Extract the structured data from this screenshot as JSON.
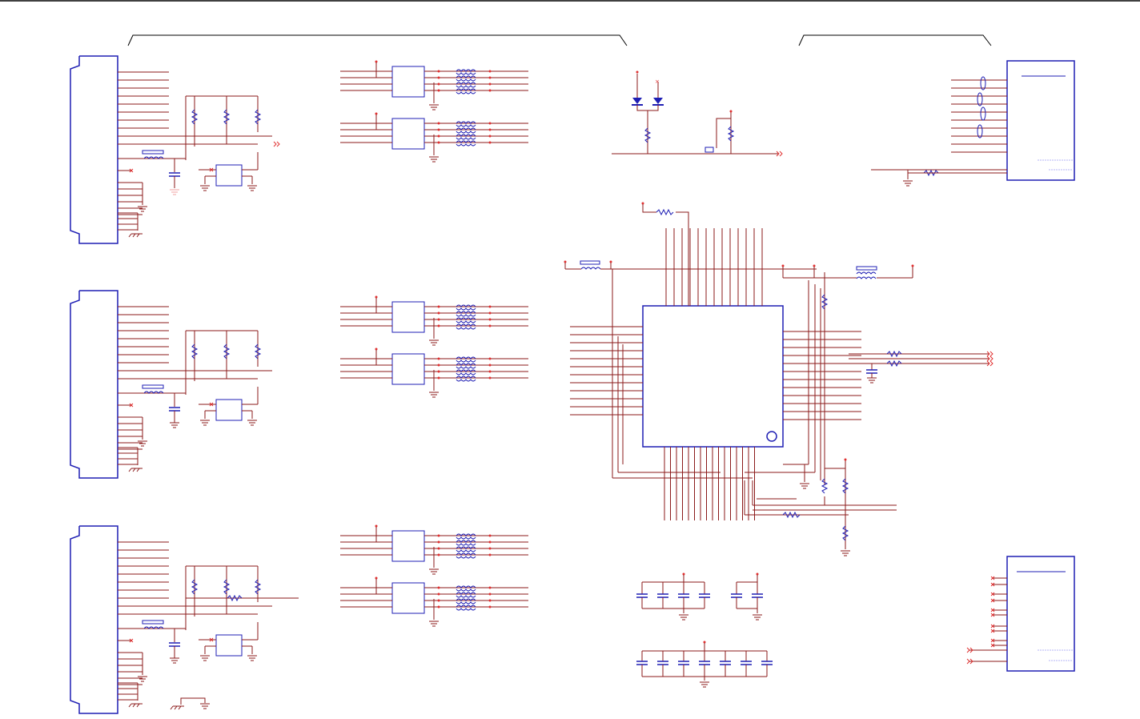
{
  "colors": {
    "wire": "#8b1a1a",
    "part": "#1f1fb4",
    "pin": "#e03030",
    "frame": "#000000",
    "hatch": "#6a6af0"
  },
  "connectors": {
    "left_count": 3,
    "right_count": 2
  },
  "ic": {
    "type": "qfp-64",
    "pin1_marker": "circle"
  },
  "blocks": {
    "transformer_groups": 6,
    "led_indicator_pair": 1,
    "decoupling_rows": 2
  }
}
